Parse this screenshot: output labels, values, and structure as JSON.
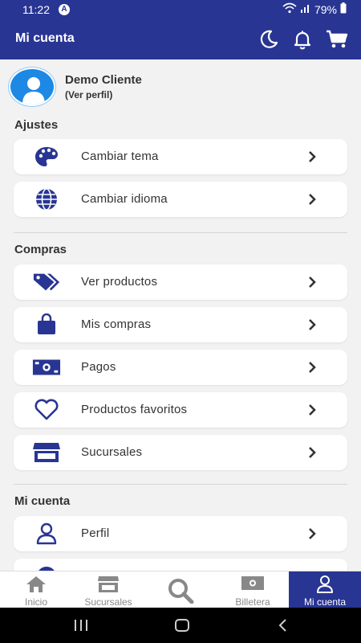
{
  "status_bar": {
    "time": "11:22",
    "badge": "A",
    "battery": "79%"
  },
  "app_bar": {
    "title": "Mi cuenta"
  },
  "profile": {
    "name": "Demo Cliente",
    "link": "(Ver perfil)"
  },
  "sections": [
    {
      "title": "Ajustes",
      "items": [
        {
          "label": "Cambiar tema",
          "icon": "palette-icon"
        },
        {
          "label": "Cambiar idioma",
          "icon": "globe-icon"
        }
      ]
    },
    {
      "title": "Compras",
      "items": [
        {
          "label": "Ver productos",
          "icon": "tags-icon"
        },
        {
          "label": "Mis compras",
          "icon": "shopping-bag-icon"
        },
        {
          "label": "Pagos",
          "icon": "money-bill-icon"
        },
        {
          "label": "Productos favoritos",
          "icon": "heart-icon"
        },
        {
          "label": "Sucursales",
          "icon": "store-icon"
        }
      ]
    },
    {
      "title": "Mi cuenta",
      "items": [
        {
          "label": "Perfil",
          "icon": "user-icon"
        }
      ]
    }
  ],
  "bottom_nav": [
    {
      "label": "Inicio",
      "icon": "home-icon",
      "active": false
    },
    {
      "label": "Sucursales",
      "icon": "store-icon",
      "active": false
    },
    {
      "label": "",
      "icon": "search-icon",
      "active": false
    },
    {
      "label": "Billetera",
      "icon": "money-bill-icon",
      "active": false
    },
    {
      "label": "Mi cuenta",
      "icon": "user-icon",
      "active": true
    }
  ],
  "colors": {
    "primary": "#283593",
    "background": "#f2f2f2",
    "avatar": "#1e88e5"
  }
}
